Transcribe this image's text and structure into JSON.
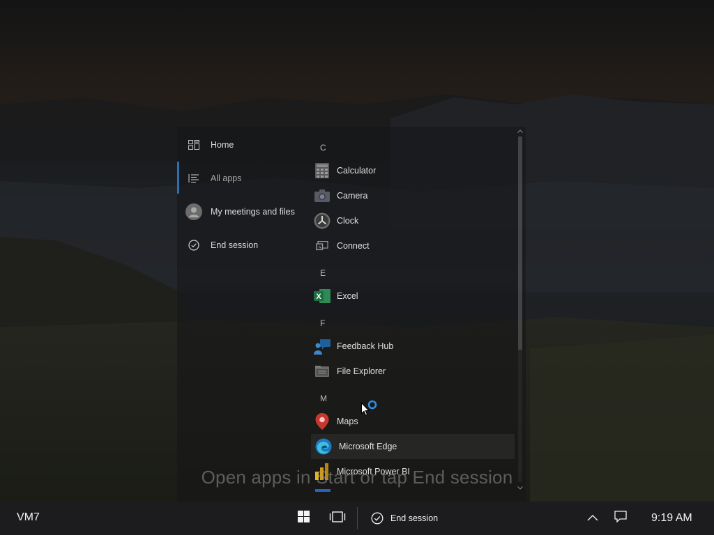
{
  "start_menu": {
    "nav": [
      {
        "label": "Home",
        "icon": "home-tiles-icon"
      },
      {
        "label": "All apps",
        "icon": "list-icon",
        "active": true
      },
      {
        "label": "My meetings and files",
        "icon": "user-avatar-icon"
      },
      {
        "label": "End session",
        "icon": "check-circle-icon"
      }
    ],
    "groups": [
      {
        "letter": "C",
        "apps": [
          "Calculator",
          "Camera",
          "Clock",
          "Connect"
        ]
      },
      {
        "letter": "E",
        "apps": [
          "Excel"
        ]
      },
      {
        "letter": "F",
        "apps": [
          "Feedback Hub",
          "File Explorer"
        ]
      },
      {
        "letter": "M",
        "apps": [
          "Maps",
          "Microsoft Edge",
          "Microsoft Power BI"
        ]
      }
    ],
    "hovered_app": "Microsoft Edge"
  },
  "overlay_text": "Open apps in Start or tap End session",
  "taskbar": {
    "vm_name": "VM7",
    "end_session_label": "End session",
    "time": "9:19 AM"
  },
  "colors": {
    "accent": "#2e6fb0",
    "excel_green": "#1d6f42",
    "powerbi_yellow": "#e8b31c",
    "maps_red": "#c8372d"
  }
}
